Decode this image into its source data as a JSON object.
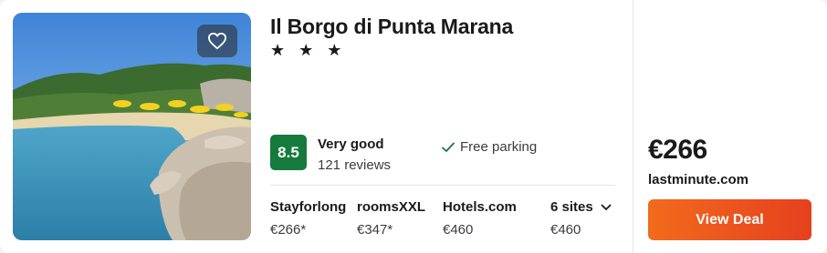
{
  "hotel": {
    "name": "Il Borgo di Punta Marana",
    "stars": "★ ★ ★"
  },
  "rating": {
    "score": "8.5",
    "label": "Very good",
    "reviews": "121 reviews",
    "badge_color": "#157a3c"
  },
  "amenities": [
    {
      "icon": "check-icon",
      "label": "Free parking"
    }
  ],
  "providers": [
    {
      "name": "Stayforlong",
      "price": "€266*"
    },
    {
      "name": "roomsXXL",
      "price": "€347*"
    },
    {
      "name": "Hotels.com",
      "price": "€460"
    },
    {
      "name": "6 sites",
      "price": "€460",
      "icon": "chevron-down-icon"
    }
  ],
  "deal": {
    "price": "€266",
    "site": "lastminute.com",
    "button_label": "View Deal",
    "button_colors": [
      "#f26b1d",
      "#e5401e"
    ]
  },
  "photo": {
    "favorite_icon": "heart-icon"
  }
}
